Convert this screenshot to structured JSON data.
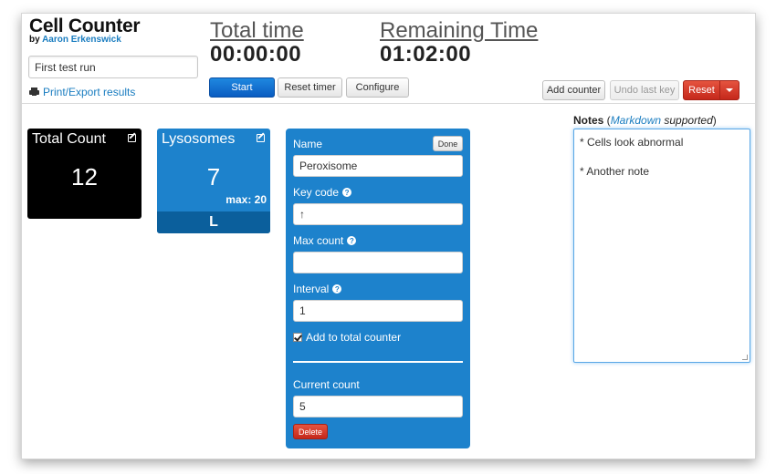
{
  "app": {
    "title": "Cell Counter",
    "byline_prefix": "by ",
    "author": "Aaron Erkenswick",
    "run_name": "First test run",
    "print_link": "Print/Export results"
  },
  "timers": {
    "total_label": "Total time",
    "total_value": "00:00:00",
    "remaining_label": "Remaining Time",
    "remaining_value": "01:02:00"
  },
  "toolbar": {
    "start": "Start",
    "reset_timer": "Reset timer",
    "configure": "Configure",
    "add_counter": "Add counter",
    "undo_last_key": "Undo last key",
    "reset": "Reset"
  },
  "tiles": {
    "total": {
      "title": "Total Count",
      "count": "12",
      "color": "#000000"
    },
    "lysosomes": {
      "title": "Lysosomes",
      "count": "7",
      "max": "max: 20",
      "key": "L",
      "color": "#1d82cc",
      "key_bar_color": "#0b5f9c"
    }
  },
  "editor": {
    "name_label": "Name",
    "done": "Done",
    "name_value": "Peroxisome",
    "key_code_label": "Key code",
    "key_code_value": "↑",
    "max_count_label": "Max count",
    "max_count_value": "",
    "interval_label": "Interval",
    "interval_value": "1",
    "add_to_total_label": "Add to total counter",
    "add_to_total_checked": true,
    "current_count_label": "Current count",
    "current_count_value": "5",
    "delete": "Delete",
    "color": "#1d82cc"
  },
  "notes": {
    "label": "Notes",
    "paren_open": " (",
    "markdown_link": "Markdown",
    "supported": " supported",
    "paren_close": ")",
    "line1": "* Cells look abnormal",
    "line2": "* Another note"
  }
}
